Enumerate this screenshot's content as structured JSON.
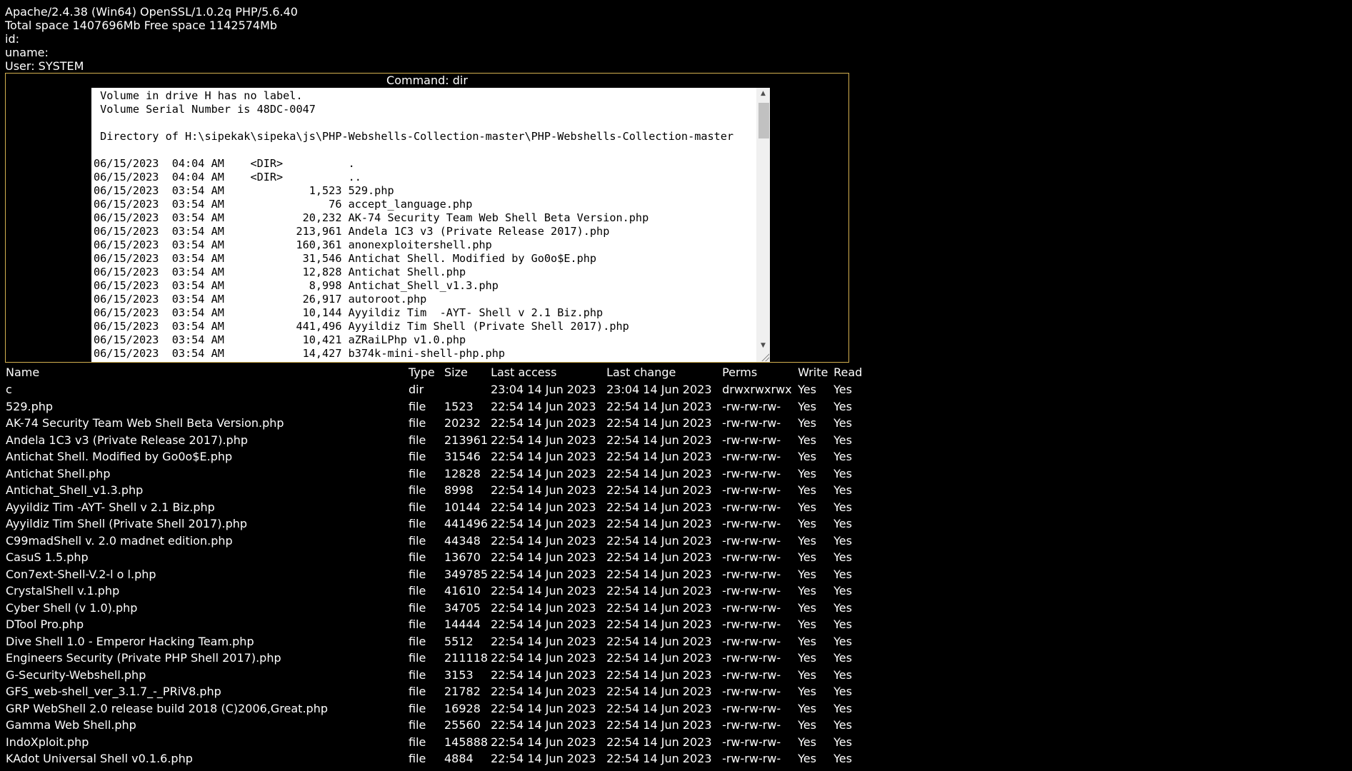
{
  "server": {
    "software": "Apache/2.4.38 (Win64) OpenSSL/1.0.2q PHP/5.6.40",
    "space": "Total space 1407696Mb Free space 1142574Mb",
    "id": "id:",
    "uname": "uname:",
    "user": "User: SYSTEM"
  },
  "command": {
    "title": "Command: dir",
    "output": " Volume in drive H has no label.\n Volume Serial Number is 48DC-0047\n\n Directory of H:\\sipekak\\sipeka\\js\\PHP-Webshells-Collection-master\\PHP-Webshells-Collection-master\n\n06/15/2023  04:04 AM    <DIR>          .\n06/15/2023  04:04 AM    <DIR>          ..\n06/15/2023  03:54 AM             1,523 529.php\n06/15/2023  03:54 AM                76 accept_language.php\n06/15/2023  03:54 AM            20,232 AK-74 Security Team Web Shell Beta Version.php\n06/15/2023  03:54 AM           213,961 Andela 1C3 v3 (Private Release 2017).php\n06/15/2023  03:54 AM           160,361 anonexploitershell.php\n06/15/2023  03:54 AM            31,546 Antichat Shell. Modified by Go0o$E.php\n06/15/2023  03:54 AM            12,828 Antichat Shell.php\n06/15/2023  03:54 AM             8,998 Antichat_Shell_v1.3.php\n06/15/2023  03:54 AM            26,917 autoroot.php\n06/15/2023  03:54 AM            10,144 Ayyildiz Tim  -AYT- Shell v 2.1 Biz.php\n06/15/2023  03:54 AM           441,496 Ayyildiz Tim Shell (Private Shell 2017).php\n06/15/2023  03:54 AM            10,421 aZRaiLPhp v1.0.php\n06/15/2023  03:54 AM            14,427 b374k-mini-shell-php.php"
  },
  "table": {
    "headers": {
      "name": "Name",
      "type": "Type",
      "size": "Size",
      "last_access": "Last access",
      "last_change": "Last change",
      "perms": "Perms",
      "write": "Write",
      "read": "Read"
    },
    "rows": [
      {
        "name": "c",
        "type": "dir",
        "size": "",
        "access": "23:04 14 Jun 2023",
        "change": "23:04 14 Jun 2023",
        "perms": "drwxrwxrwx",
        "write": "Yes",
        "read": "Yes"
      },
      {
        "name": "529.php",
        "type": "file",
        "size": "1523",
        "access": "22:54 14 Jun 2023",
        "change": "22:54 14 Jun 2023",
        "perms": "-rw-rw-rw-",
        "write": "Yes",
        "read": "Yes"
      },
      {
        "name": "AK-74 Security Team Web Shell Beta Version.php",
        "type": "file",
        "size": "20232",
        "access": "22:54 14 Jun 2023",
        "change": "22:54 14 Jun 2023",
        "perms": "-rw-rw-rw-",
        "write": "Yes",
        "read": "Yes"
      },
      {
        "name": "Andela 1C3 v3 (Private Release 2017).php",
        "type": "file",
        "size": "213961",
        "access": "22:54 14 Jun 2023",
        "change": "22:54 14 Jun 2023",
        "perms": "-rw-rw-rw-",
        "write": "Yes",
        "read": "Yes"
      },
      {
        "name": "Antichat Shell. Modified by Go0o$E.php",
        "type": "file",
        "size": "31546",
        "access": "22:54 14 Jun 2023",
        "change": "22:54 14 Jun 2023",
        "perms": "-rw-rw-rw-",
        "write": "Yes",
        "read": "Yes"
      },
      {
        "name": "Antichat Shell.php",
        "type": "file",
        "size": "12828",
        "access": "22:54 14 Jun 2023",
        "change": "22:54 14 Jun 2023",
        "perms": "-rw-rw-rw-",
        "write": "Yes",
        "read": "Yes"
      },
      {
        "name": "Antichat_Shell_v1.3.php",
        "type": "file",
        "size": "8998",
        "access": "22:54 14 Jun 2023",
        "change": "22:54 14 Jun 2023",
        "perms": "-rw-rw-rw-",
        "write": "Yes",
        "read": "Yes"
      },
      {
        "name": "Ayyildiz Tim -AYT- Shell v 2.1 Biz.php",
        "type": "file",
        "size": "10144",
        "access": "22:54 14 Jun 2023",
        "change": "22:54 14 Jun 2023",
        "perms": "-rw-rw-rw-",
        "write": "Yes",
        "read": "Yes"
      },
      {
        "name": "Ayyildiz Tim Shell (Private Shell 2017).php",
        "type": "file",
        "size": "441496",
        "access": "22:54 14 Jun 2023",
        "change": "22:54 14 Jun 2023",
        "perms": "-rw-rw-rw-",
        "write": "Yes",
        "read": "Yes"
      },
      {
        "name": "C99madShell v. 2.0 madnet edition.php",
        "type": "file",
        "size": "44348",
        "access": "22:54 14 Jun 2023",
        "change": "22:54 14 Jun 2023",
        "perms": "-rw-rw-rw-",
        "write": "Yes",
        "read": "Yes"
      },
      {
        "name": "CasuS 1.5.php",
        "type": "file",
        "size": "13670",
        "access": "22:54 14 Jun 2023",
        "change": "22:54 14 Jun 2023",
        "perms": "-rw-rw-rw-",
        "write": "Yes",
        "read": "Yes"
      },
      {
        "name": "Con7ext-Shell-V.2-l o l.php",
        "type": "file",
        "size": "349785",
        "access": "22:54 14 Jun 2023",
        "change": "22:54 14 Jun 2023",
        "perms": "-rw-rw-rw-",
        "write": "Yes",
        "read": "Yes"
      },
      {
        "name": "CrystalShell v.1.php",
        "type": "file",
        "size": "41610",
        "access": "22:54 14 Jun 2023",
        "change": "22:54 14 Jun 2023",
        "perms": "-rw-rw-rw-",
        "write": "Yes",
        "read": "Yes"
      },
      {
        "name": "Cyber Shell (v 1.0).php",
        "type": "file",
        "size": "34705",
        "access": "22:54 14 Jun 2023",
        "change": "22:54 14 Jun 2023",
        "perms": "-rw-rw-rw-",
        "write": "Yes",
        "read": "Yes"
      },
      {
        "name": "DTool Pro.php",
        "type": "file",
        "size": "14444",
        "access": "22:54 14 Jun 2023",
        "change": "22:54 14 Jun 2023",
        "perms": "-rw-rw-rw-",
        "write": "Yes",
        "read": "Yes"
      },
      {
        "name": "Dive Shell 1.0 - Emperor Hacking Team.php",
        "type": "file",
        "size": "5512",
        "access": "22:54 14 Jun 2023",
        "change": "22:54 14 Jun 2023",
        "perms": "-rw-rw-rw-",
        "write": "Yes",
        "read": "Yes"
      },
      {
        "name": "Engineers Security (Private PHP Shell 2017).php",
        "type": "file",
        "size": "211118",
        "access": "22:54 14 Jun 2023",
        "change": "22:54 14 Jun 2023",
        "perms": "-rw-rw-rw-",
        "write": "Yes",
        "read": "Yes"
      },
      {
        "name": "G-Security-Webshell.php",
        "type": "file",
        "size": "3153",
        "access": "22:54 14 Jun 2023",
        "change": "22:54 14 Jun 2023",
        "perms": "-rw-rw-rw-",
        "write": "Yes",
        "read": "Yes"
      },
      {
        "name": "GFS_web-shell_ver_3.1.7_-_PRiV8.php",
        "type": "file",
        "size": "21782",
        "access": "22:54 14 Jun 2023",
        "change": "22:54 14 Jun 2023",
        "perms": "-rw-rw-rw-",
        "write": "Yes",
        "read": "Yes"
      },
      {
        "name": "GRP WebShell 2.0 release build 2018 (C)2006,Great.php",
        "type": "file",
        "size": "16928",
        "access": "22:54 14 Jun 2023",
        "change": "22:54 14 Jun 2023",
        "perms": "-rw-rw-rw-",
        "write": "Yes",
        "read": "Yes"
      },
      {
        "name": "Gamma Web Shell.php",
        "type": "file",
        "size": "25560",
        "access": "22:54 14 Jun 2023",
        "change": "22:54 14 Jun 2023",
        "perms": "-rw-rw-rw-",
        "write": "Yes",
        "read": "Yes"
      },
      {
        "name": "IndoXploit.php",
        "type": "file",
        "size": "145888",
        "access": "22:54 14 Jun 2023",
        "change": "22:54 14 Jun 2023",
        "perms": "-rw-rw-rw-",
        "write": "Yes",
        "read": "Yes"
      },
      {
        "name": "KAdot Universal Shell v0.1.6.php",
        "type": "file",
        "size": "4884",
        "access": "22:54 14 Jun 2023",
        "change": "22:54 14 Jun 2023",
        "perms": "-rw-rw-rw-",
        "write": "Yes",
        "read": "Yes"
      }
    ]
  }
}
